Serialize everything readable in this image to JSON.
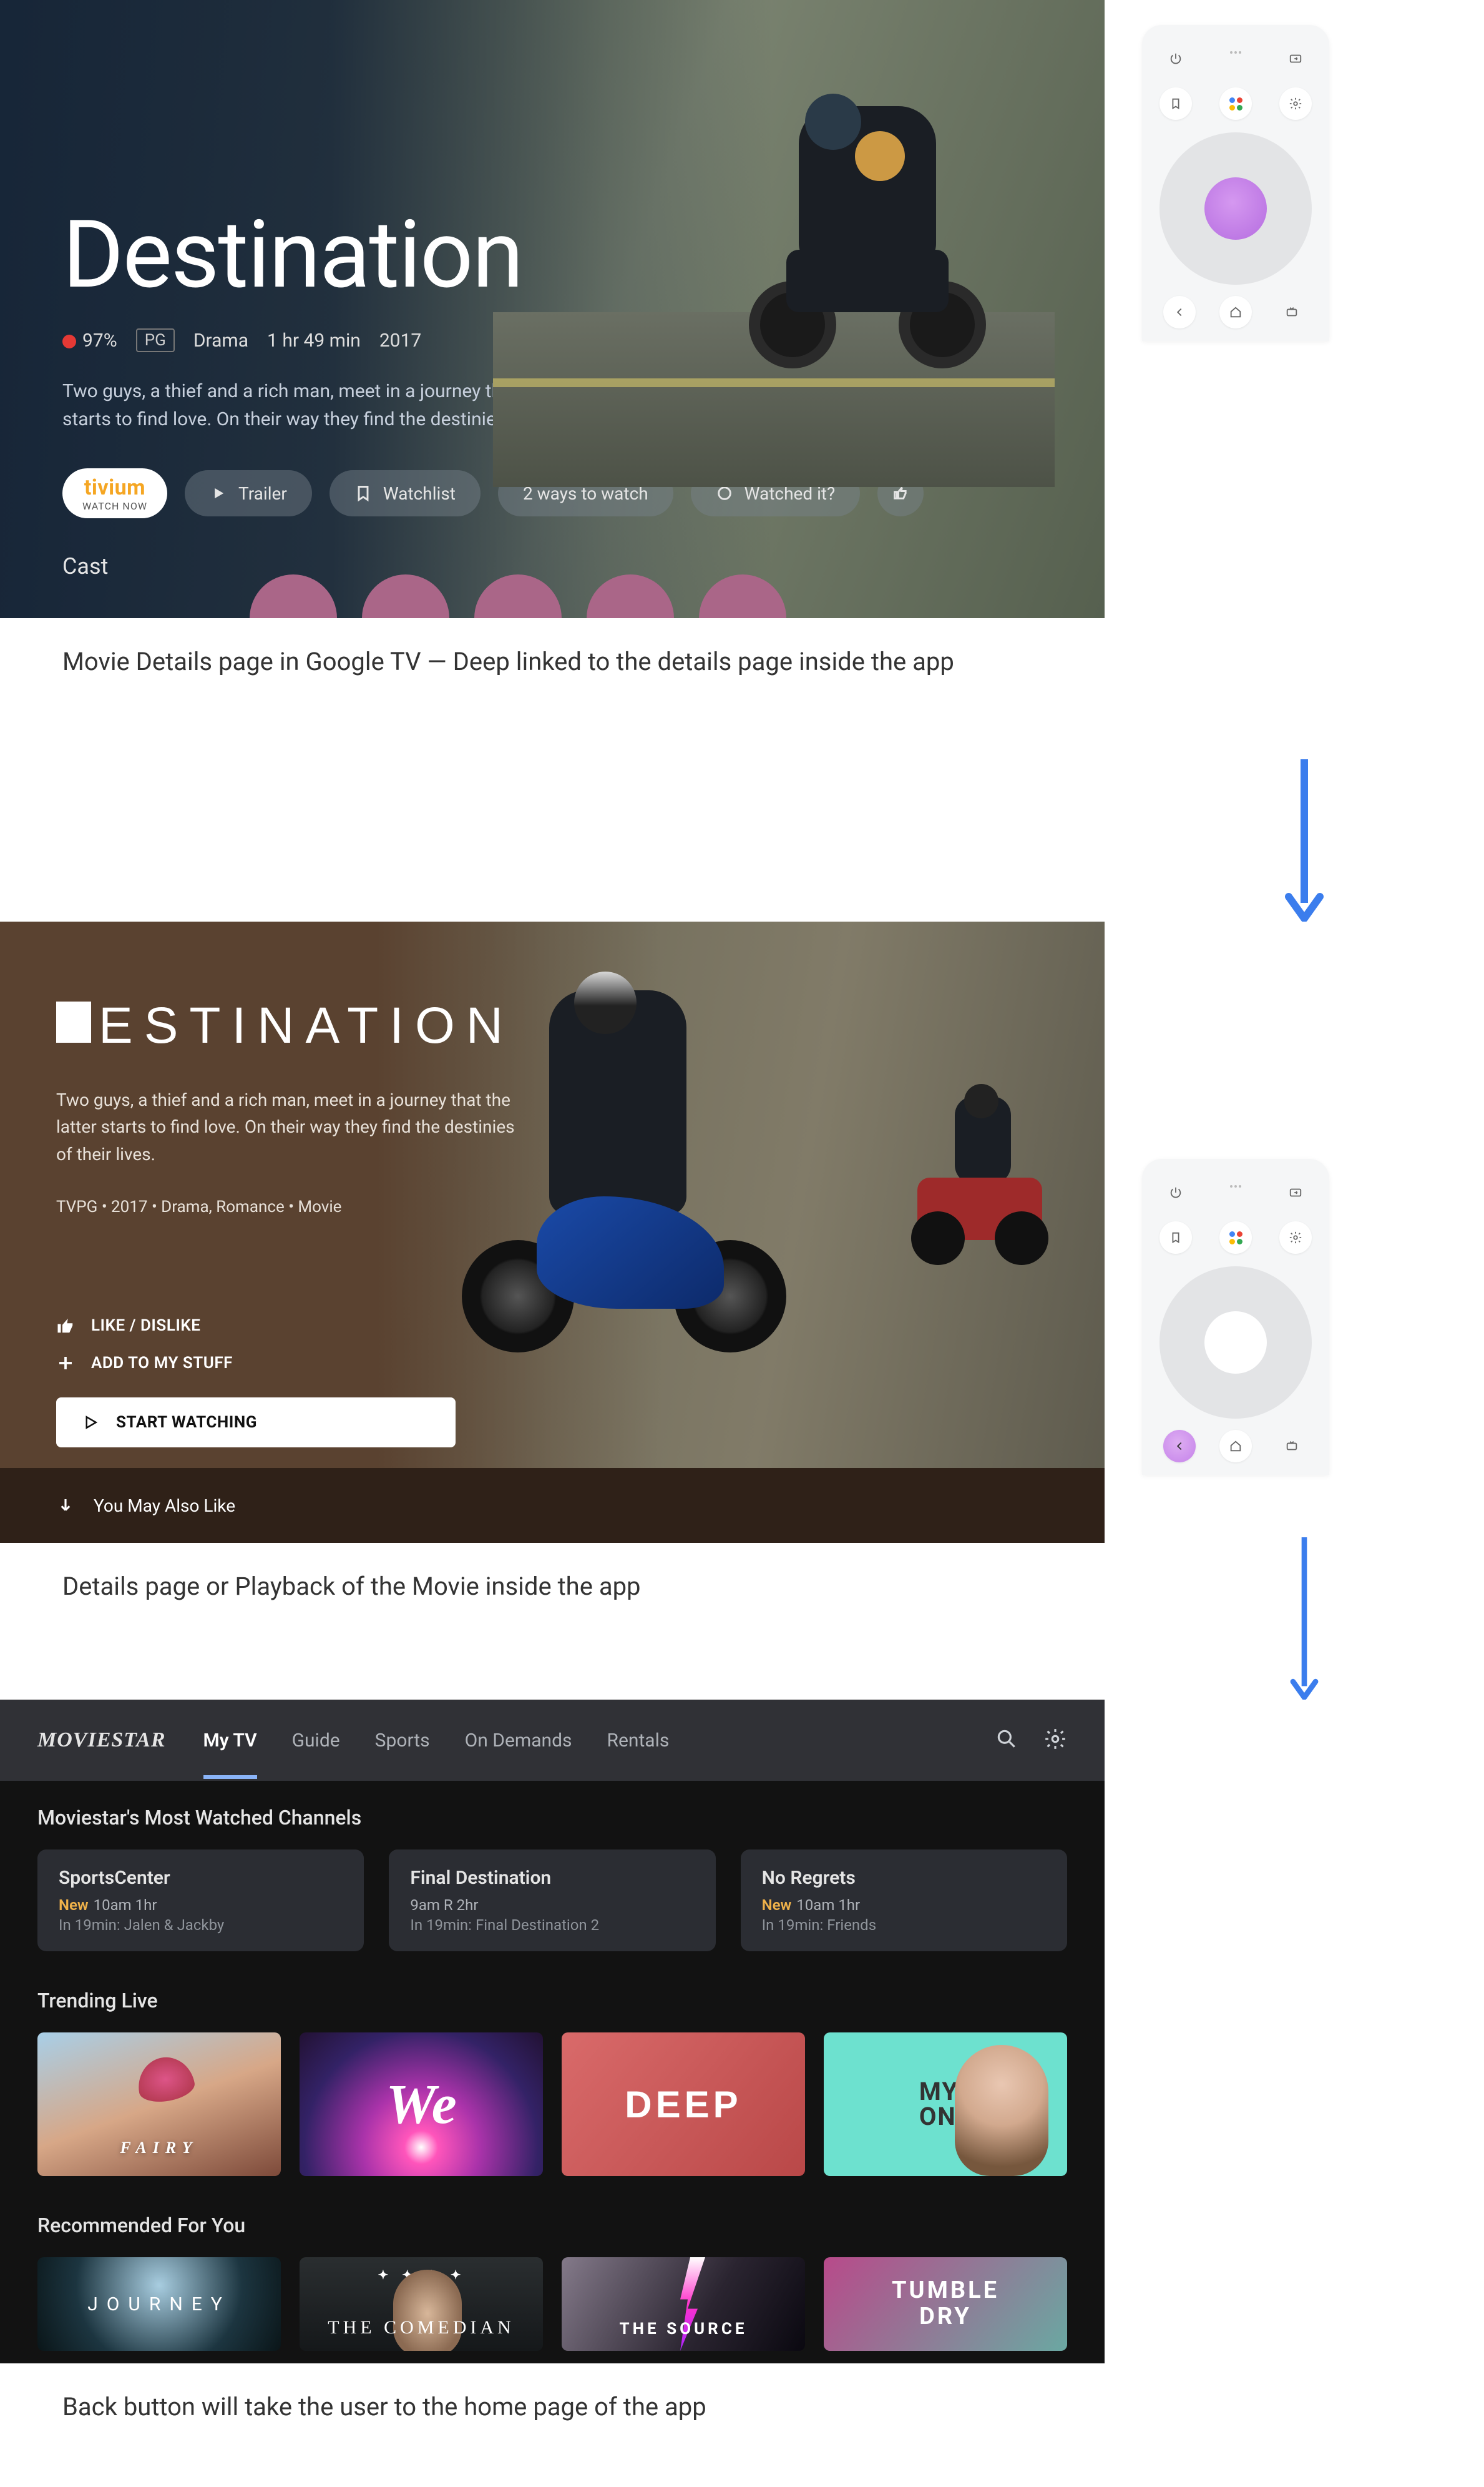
{
  "screen1": {
    "title": "Destination",
    "score": "97%",
    "rating": "PG",
    "genre": "Drama",
    "runtime": "1 hr 49 min",
    "year": "2017",
    "description": "Two guys, a thief and a rich man, meet in a journey that the latter starts to find love. On their way they find the destinies of their lives.",
    "provider": {
      "name": "tivium",
      "sub": "WATCH NOW"
    },
    "buttons": {
      "trailer": "Trailer",
      "watchlist": "Watchlist",
      "ways": "2 ways to watch",
      "watched": "Watched it?"
    },
    "cast_label": "Cast"
  },
  "caption1": "Movie Details page in Google TV — Deep linked to the details page inside the app",
  "screen2": {
    "title": "ESTINATION",
    "description": "Two guys, a thief and a rich man, meet in a journey that the latter starts to find love. On their way they find the destinies of their lives.",
    "meta": "TVPG • 2017 • Drama, Romance • Movie",
    "like": "LIKE / DISLIKE",
    "add": "ADD TO MY STUFF",
    "start": "START WATCHING",
    "also": "You May Also Like"
  },
  "caption2": "Details page or Playback of the Movie inside the app",
  "screen3": {
    "brand": "MOVIESTAR",
    "tabs": [
      "My TV",
      "Guide",
      "Sports",
      "On Demands",
      "Rentals"
    ],
    "sec1": "Moviestar's Most Watched Channels",
    "channels": [
      {
        "title": "SportsCenter",
        "new": "New",
        "l2": "10am 1hr",
        "l3": "In 19min: Jalen & Jackby"
      },
      {
        "title": "Final Destination",
        "new": "",
        "l2": "9am R 2hr",
        "l3": "In 19min: Final Destination 2"
      },
      {
        "title": "No Regrets",
        "new": "New",
        "l2": "10am 1hr",
        "l3": "In 19min: Friends"
      }
    ],
    "sec2": "Trending Live",
    "trending": [
      "FAIRY",
      "We",
      "DEEP",
      "MY\nONE"
    ],
    "sec3": "Recommended For You",
    "recommended": [
      "JOURNEY",
      "THE COMEDIAN",
      "THE SOURCE",
      "TUMBLE\nDRY"
    ]
  },
  "caption3": "Back button will take the user to the home page of the app"
}
